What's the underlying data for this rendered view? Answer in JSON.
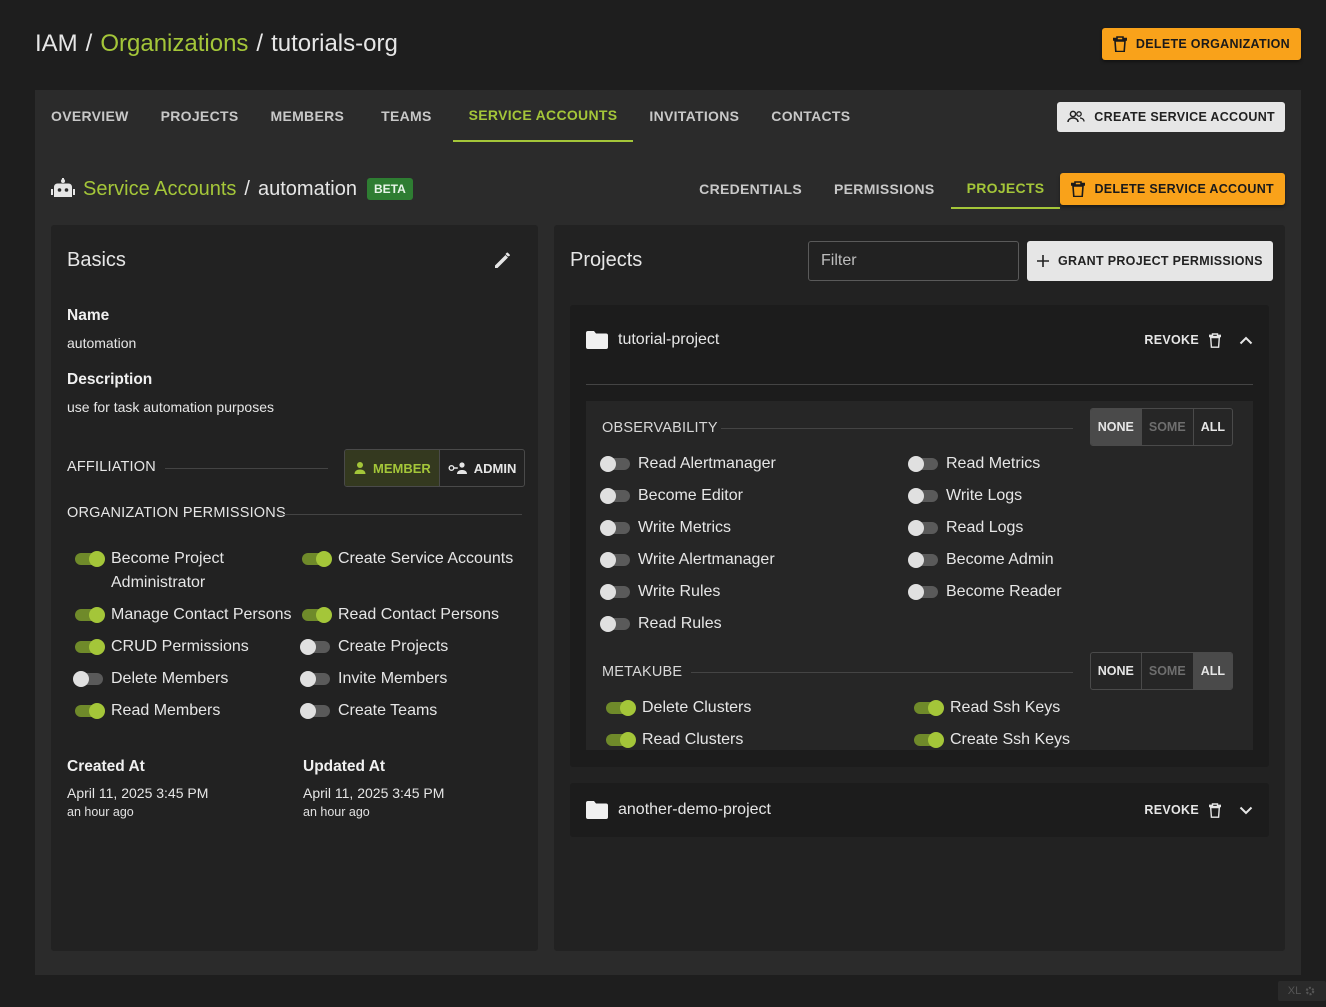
{
  "breadcrumb": {
    "root": "IAM",
    "sep": "/",
    "section": "Organizations",
    "current": "tutorials-org"
  },
  "delete_org_label": "DELETE ORGANIZATION",
  "tabs": [
    {
      "label": "OVERVIEW"
    },
    {
      "label": "PROJECTS"
    },
    {
      "label": "MEMBERS"
    },
    {
      "label": "TEAMS"
    },
    {
      "label": "SERVICE ACCOUNTS"
    },
    {
      "label": "INVITATIONS"
    },
    {
      "label": "CONTACTS"
    }
  ],
  "create_sa_label": "CREATE SERVICE ACCOUNT",
  "sa": {
    "section": "Service Accounts",
    "sep": "/",
    "name": "automation",
    "badge": "BETA"
  },
  "sub_tabs": [
    {
      "label": "CREDENTIALS"
    },
    {
      "label": "PERMISSIONS"
    },
    {
      "label": "PROJECTS"
    }
  ],
  "delete_sa_label": "DELETE SERVICE ACCOUNT",
  "basics": {
    "title": "Basics",
    "name_label": "Name",
    "name_value": "automation",
    "desc_label": "Description",
    "desc_value": "use for task automation purposes",
    "affiliation_label": "AFFILIATION",
    "affiliation": {
      "member": "MEMBER",
      "admin": "ADMIN",
      "selected": "MEMBER"
    },
    "org_perm_label": "ORGANIZATION PERMISSIONS",
    "perms": [
      {
        "label": "Become Project Administrator",
        "on": true
      },
      {
        "label": "Create Service Accounts",
        "on": true
      },
      {
        "label": "Manage Contact Persons",
        "on": true
      },
      {
        "label": "Read Contact Persons",
        "on": true
      },
      {
        "label": "CRUD Permissions",
        "on": true
      },
      {
        "label": "Create Projects",
        "on": false
      },
      {
        "label": "Delete Members",
        "on": false
      },
      {
        "label": "Invite Members",
        "on": false
      },
      {
        "label": "Read Members",
        "on": true
      },
      {
        "label": "Create Teams",
        "on": false
      }
    ],
    "created_label": "Created At",
    "created_value": "April 11, 2025 3:45 PM",
    "created_rel": "an hour ago",
    "updated_label": "Updated At",
    "updated_value": "April 11, 2025 3:45 PM",
    "updated_rel": "an hour ago"
  },
  "projects": {
    "title": "Projects",
    "filter_placeholder": "Filter",
    "grant_label": "GRANT PROJECT PERMISSIONS",
    "items": [
      {
        "name": "tutorial-project",
        "revoke": "REVOKE",
        "expanded": true
      },
      {
        "name": "another-demo-project",
        "revoke": "REVOKE",
        "expanded": false
      }
    ],
    "segments": {
      "none": "NONE",
      "some": "SOME",
      "all": "ALL"
    },
    "groups": [
      {
        "title": "OBSERVABILITY",
        "selected": "NONE",
        "perms": [
          {
            "label": "Read Alertmanager",
            "on": false
          },
          {
            "label": "Read Metrics",
            "on": false
          },
          {
            "label": "Become Editor",
            "on": false
          },
          {
            "label": "Write Logs",
            "on": false
          },
          {
            "label": "Write Metrics",
            "on": false
          },
          {
            "label": "Read Logs",
            "on": false
          },
          {
            "label": "Write Alertmanager",
            "on": false
          },
          {
            "label": "Become Admin",
            "on": false
          },
          {
            "label": "Write Rules",
            "on": false
          },
          {
            "label": "Become Reader",
            "on": false
          },
          {
            "label": "Read Rules",
            "on": false
          }
        ]
      },
      {
        "title": "METAKUBE",
        "selected": "ALL",
        "perms": [
          {
            "label": "Delete Clusters",
            "on": true
          },
          {
            "label": "Read Ssh Keys",
            "on": true
          },
          {
            "label": "Read Clusters",
            "on": true
          },
          {
            "label": "Create Ssh Keys",
            "on": true
          }
        ]
      }
    ]
  },
  "watermark": "XL"
}
